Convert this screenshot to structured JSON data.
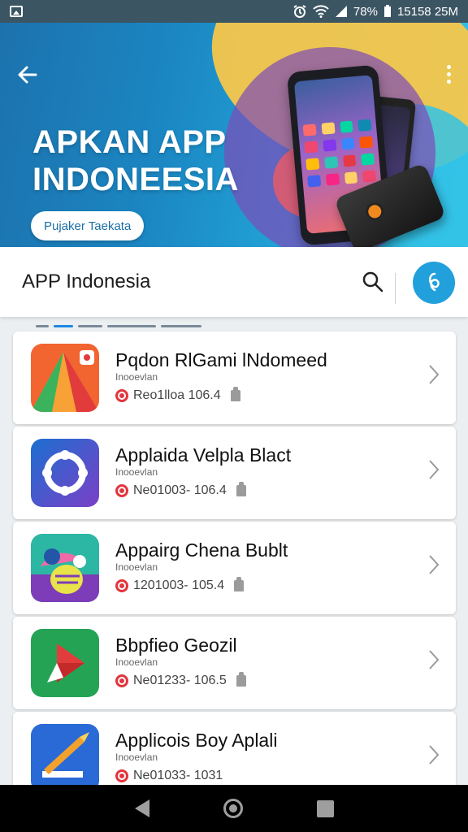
{
  "status_bar": {
    "battery": "78%",
    "time": "15158 25M"
  },
  "hero": {
    "title_line1": "APKAN APP",
    "title_line2": "INDONEESIA",
    "cta_label": "Pujaker Taekata"
  },
  "header": {
    "title": "APP Indonesia"
  },
  "apps": [
    {
      "name": "Pqdon RlGami lNdomeed",
      "developer": "Inooevlan",
      "stats": "Reo1lloa 106.4",
      "icon_colors": [
        "#f2642c",
        "#3bb25c"
      ]
    },
    {
      "name": "Applaida Velpla Blact",
      "developer": "Inooevlan",
      "stats": "Ne01003- 106.4",
      "icon_colors": [
        "#5f3ec4",
        "#1c6fd1"
      ]
    },
    {
      "name": "Appairg Chena Bublt",
      "developer": "Inooevlan",
      "stats": "1201003- 105.4",
      "icon_colors": [
        "#2cb7a4",
        "#7d3db8"
      ]
    },
    {
      "name": "Bbpfieo Geozil",
      "developer": "Inooevlan",
      "stats": "Ne01233- 106.5",
      "icon_colors": [
        "#24a355",
        "#e33c3c"
      ]
    },
    {
      "name": "Applicois Boy Aplali",
      "developer": "Inooevlan",
      "stats": "Ne01033- 1031",
      "icon_colors": [
        "#2a6ad6",
        "#f2a22c"
      ]
    }
  ],
  "icons": {
    "back": "arrow-left-icon",
    "menu": "more-vert-icon",
    "search": "search-icon",
    "mic": "voice-icon",
    "chevron": "chevron-right-icon"
  },
  "colors": {
    "accent": "#21a0dc",
    "status_bar": "#3b5563"
  }
}
